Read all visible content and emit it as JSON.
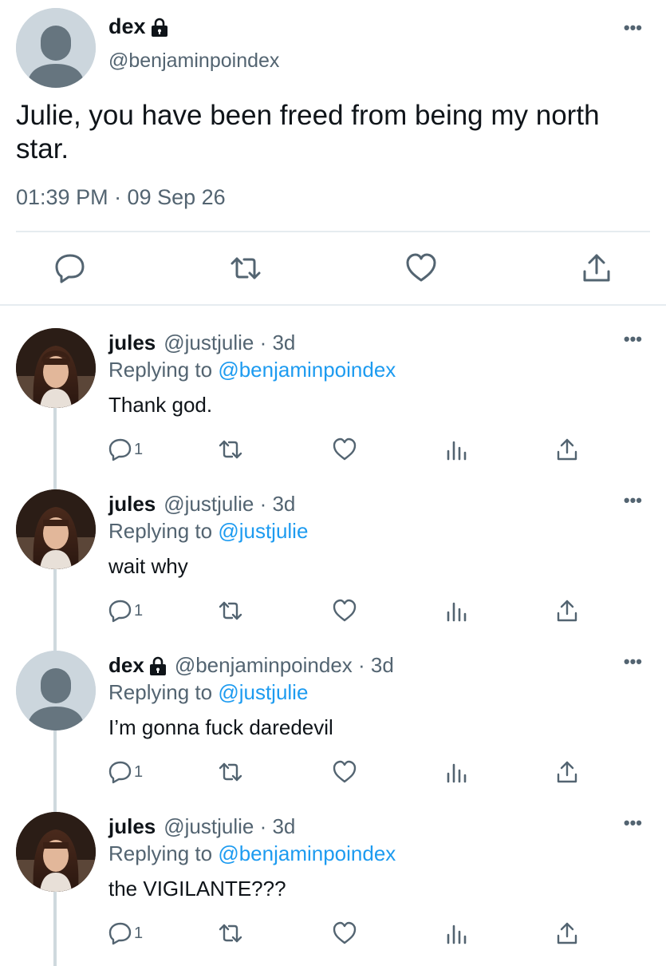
{
  "tweet": {
    "author_name": "dex",
    "handle": "@benjaminpoindex",
    "text": "Julie, you have been freed from being my north star.",
    "timestamp": "01:39 PM · 09 Sep 26",
    "more_label": "•••"
  },
  "icons": {
    "lock": "lock-icon",
    "reply": "reply-icon",
    "retweet": "retweet-icon",
    "like": "heart-icon",
    "share": "share-icon",
    "analytics": "analytics-icon"
  },
  "colors": {
    "link": "#1d9bf0",
    "secondary": "#536471",
    "text": "#0f1419",
    "divider": "#e6ecf0",
    "thread_line": "#cfd9de"
  },
  "replies": [
    {
      "name": "jules",
      "meta": "@justjulie · 3d",
      "replying_label": "Replying to ",
      "replying_to": "@benjaminpoindex",
      "text": "Thank god.",
      "reply_count": "1",
      "locked": false
    },
    {
      "name": "jules",
      "meta": "@justjulie · 3d",
      "replying_label": "Replying to ",
      "replying_to": "@justjulie",
      "text": "wait why",
      "reply_count": "1",
      "locked": false
    },
    {
      "name": "dex",
      "meta": "@benjaminpoindex · 3d",
      "replying_label": "Replying to ",
      "replying_to": "@justjulie",
      "text": "I’m gonna fuck daredevil",
      "reply_count": "1",
      "locked": true
    },
    {
      "name": "jules",
      "meta": "@justjulie · 3d",
      "replying_label": "Replying to ",
      "replying_to": "@benjaminpoindex",
      "text": "the VIGILANTE???",
      "reply_count": "1",
      "locked": false
    }
  ]
}
